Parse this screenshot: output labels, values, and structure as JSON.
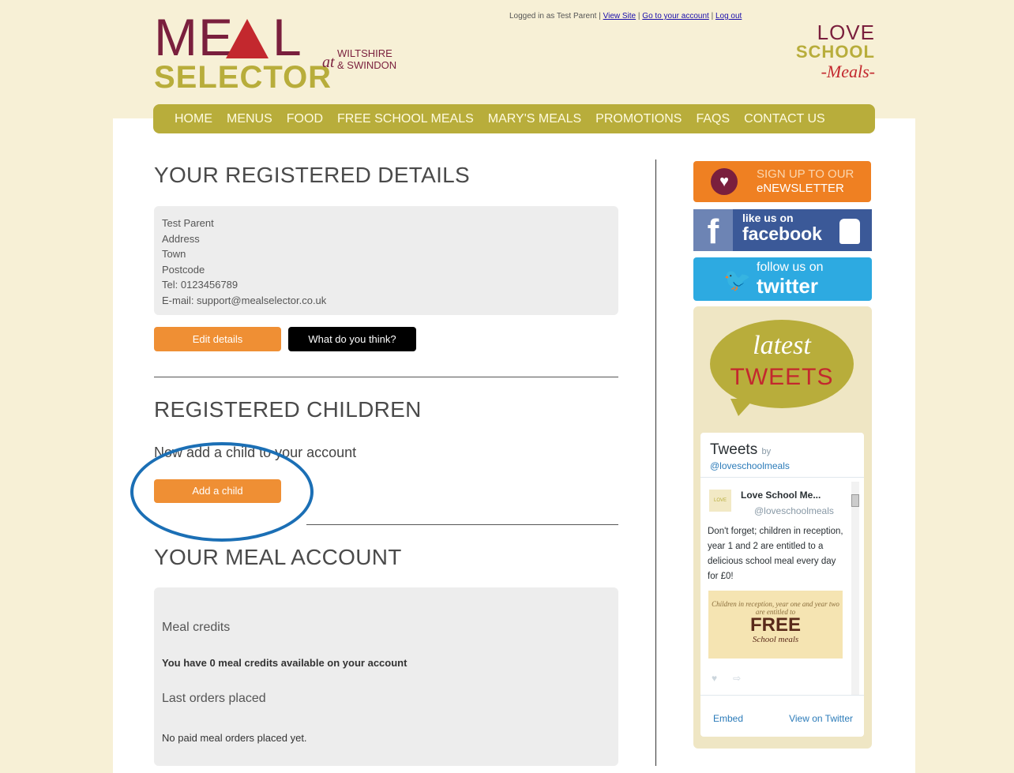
{
  "header": {
    "logo_top": "ME",
    "logo_l": "L",
    "logo_bottom": "SELECTOR",
    "logo_at": "at",
    "logo_region_1": "WILTSHIRE",
    "logo_region_2": "& SWINDON",
    "logged_in_text": "Logged in as Test Parent |",
    "link_view_site": "View Site",
    "sep1": "|",
    "link_account": "Go to your account",
    "sep2": "|",
    "link_logout": "Log out",
    "partner_love": "LOVE",
    "partner_school": "SCHOOL",
    "partner_meals": "-Meals-"
  },
  "nav": {
    "items": [
      "HOME",
      "MENUS",
      "FOOD",
      "FREE SCHOOL MEALS",
      "MARY'S MEALS",
      "PROMOTIONS",
      "FAQS",
      "CONTACT US"
    ]
  },
  "details": {
    "heading": "YOUR REGISTERED DETAILS",
    "lines": [
      "Test Parent",
      "Address",
      "Town",
      "Postcode",
      "Tel: 0123456789",
      "E-mail: support@mealselector.co.uk"
    ],
    "edit_button": "Edit details",
    "feedback_button": "What do you think?"
  },
  "children": {
    "heading": "REGISTERED CHILDREN",
    "prompt": "Now add a child to your account",
    "add_button": "Add a child"
  },
  "account": {
    "heading": "YOUR MEAL ACCOUNT",
    "credits_title": "Meal credits",
    "credits_text": "You have 0 meal credits available on your account",
    "orders_title": "Last orders placed",
    "orders_text": "No paid meal orders placed yet."
  },
  "sidebar": {
    "newsletter_1": "SIGN UP TO OUR",
    "newsletter_2": "eNEWSLETTER",
    "fb_1": "like us on",
    "fb_2": "facebook",
    "tw_1": "follow us on",
    "tw_2": "twitter",
    "latest": "latest",
    "tweets_word": "TWEETS"
  },
  "twitter_widget": {
    "title": "Tweets",
    "by": "by",
    "handle": "@loveschoolmeals",
    "tweet_name": "Love School Me...",
    "tweet_handle": "@loveschoolmeals",
    "tweet_text": "Don't forget; children in reception, year 1 and 2 are entitled to a delicious school meal every day for £0!",
    "img_line1": "Children in reception, year one and year two are entitled to",
    "img_line2": "FREE",
    "img_line3": "School meals",
    "embed": "Embed",
    "view_on_twitter": "View on Twitter"
  },
  "colors": {
    "brand_maroon": "#7a1f3d",
    "brand_olive": "#b8ad3b",
    "button_orange": "#ef8f34",
    "annotation_blue": "#1b6fb5"
  }
}
